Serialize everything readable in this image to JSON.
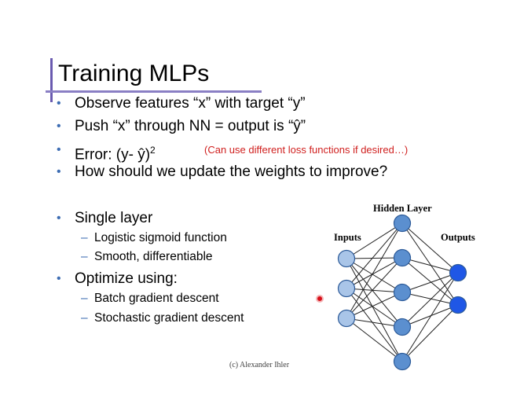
{
  "slide": {
    "title": "Training MLPs",
    "bullets_top": [
      "Observe features “x” with target “y”",
      "Push “x” through NN = output is “ŷ”",
      "Error:  (y- ŷ)",
      "How should we update the weights to improve?"
    ],
    "error_superscript": "2",
    "error_note": "(Can use different loss functions if desired…)",
    "bullet_single_layer": "Single layer",
    "single_layer_subs": [
      "Logistic sigmoid function",
      "Smooth, differentiable"
    ],
    "bullet_optimize": "Optimize using:",
    "optimize_subs": [
      "Batch gradient descent",
      "Stochastic gradient descent"
    ],
    "bullet_marker": "•",
    "sub_marker": "–",
    "footer": "(c) Alexander Ihler"
  },
  "diagram": {
    "label_hidden": "Hidden Layer",
    "label_inputs": "Inputs",
    "label_outputs": "Outputs",
    "input_count": 3,
    "hidden_count": 5,
    "output_count": 2,
    "colors": {
      "input_fill": "#a9c5e8",
      "hidden_fill": "#5b8fcf",
      "output_fill": "#1f57e6",
      "node_stroke": "#2d5b99",
      "edge": "#222222"
    }
  },
  "colors": {
    "accent_bar": "#6a5bb0",
    "bullet": "#3d6db3",
    "note": "#d0201f"
  }
}
